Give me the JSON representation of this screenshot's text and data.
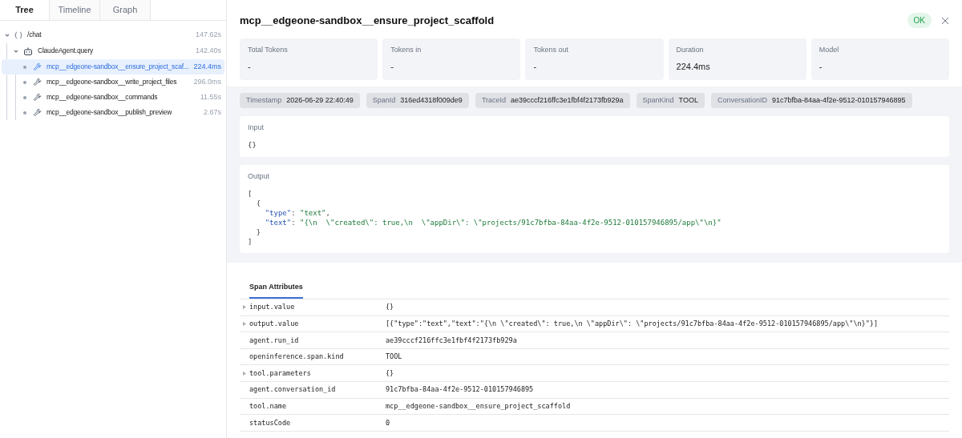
{
  "tabs": [
    {
      "label": "Tree",
      "selected": true
    },
    {
      "label": "Timeline",
      "selected": false
    },
    {
      "label": "Graph",
      "selected": false
    }
  ],
  "tree": [
    {
      "kind": "chain",
      "label": "/chat",
      "duration": "147.62s",
      "expanded": true,
      "selected": false,
      "children": [
        {
          "kind": "agent",
          "label": "ClaudeAgent.query",
          "duration": "142.40s",
          "expanded": true,
          "selected": false,
          "children": [
            {
              "kind": "tool",
              "label": "mcp__edgeone-sandbox__ensure_project_scaf...",
              "duration": "224.4ms",
              "selected": true
            },
            {
              "kind": "tool",
              "label": "mcp__edgeone-sandbox__write_project_files",
              "duration": "296.0ms",
              "selected": false
            },
            {
              "kind": "tool",
              "label": "mcp__edgeone-sandbox__commands",
              "duration": "11.55s",
              "selected": false
            },
            {
              "kind": "tool",
              "label": "mcp__edgeone-sandbox__publish_preview",
              "duration": "2.67s",
              "selected": false
            }
          ]
        }
      ]
    }
  ],
  "detail": {
    "title": "mcp__edgeone-sandbox__ensure_project_scaffold",
    "status": "OK",
    "stats": [
      {
        "label": "Total Tokens",
        "value": "-"
      },
      {
        "label": "Tokens in",
        "value": "-"
      },
      {
        "label": "Tokens out",
        "value": "-"
      },
      {
        "label": "Duration",
        "value": "224.4ms"
      },
      {
        "label": "Model",
        "value": "-"
      }
    ],
    "tags": [
      {
        "label": "Timestamp",
        "value": "2026-06-29 22:40:49"
      },
      {
        "label": "SpanId",
        "value": "316ed4318f009de9"
      },
      {
        "label": "TraceId",
        "value": "ae39cccf216ffc3e1fbf4f2173fb929a"
      },
      {
        "label": "SpanKind",
        "value": "TOOL"
      },
      {
        "label": "ConversationID",
        "value": "91c7bfba-84aa-4f2e-9512-010157946895"
      }
    ],
    "input": {
      "label": "Input",
      "value": "{}"
    },
    "output": {
      "label": "Output",
      "lines": [
        [
          {
            "t": "[",
            "kind": "punct"
          }
        ],
        [
          {
            "t": "  {",
            "kind": "punct"
          }
        ],
        [
          {
            "t": "    \"type\"",
            "kind": "key"
          },
          {
            "t": ": ",
            "kind": "punct"
          },
          {
            "t": "\"text\"",
            "kind": "string"
          },
          {
            "t": ",",
            "kind": "punct"
          }
        ],
        [
          {
            "t": "    \"text\"",
            "kind": "key"
          },
          {
            "t": ": ",
            "kind": "punct"
          },
          {
            "t": "\"{\\n  \\\"created\\\": true,\\n  \\\"appDir\\\": \\\"projects/91c7bfba-84aa-4f2e-9512-010157946895/app\\\"\\n}\"",
            "kind": "string"
          }
        ],
        [
          {
            "t": "  }",
            "kind": "punct"
          }
        ],
        [
          {
            "t": "]",
            "kind": "punct"
          }
        ]
      ]
    }
  },
  "attributes": {
    "tab": "Span Attributes",
    "rows": [
      {
        "key": "input.value",
        "value": "{}",
        "expandable": true
      },
      {
        "key": "output.value",
        "value": "[{\"type\":\"text\",\"text\":\"{\\n \\\"created\\\": true,\\n \\\"appDir\\\": \\\"projects/91c7bfba-84aa-4f2e-9512-010157946895/app\\\"\\n}\"}]",
        "expandable": true
      },
      {
        "key": "agent.run_id",
        "value": "ae39cccf216ffc3e1fbf4f2173fb929a",
        "expandable": false
      },
      {
        "key": "openinference.span.kind",
        "value": "TOOL",
        "expandable": false
      },
      {
        "key": "tool.parameters",
        "value": "{}",
        "expandable": true
      },
      {
        "key": "agent.conversation_id",
        "value": "91c7bfba-84aa-4f2e-9512-010157946895",
        "expandable": false
      },
      {
        "key": "tool.name",
        "value": "mcp__edgeone-sandbox__ensure_project_scaffold",
        "expandable": false
      },
      {
        "key": "statusCode",
        "value": "0",
        "expandable": false
      }
    ]
  }
}
